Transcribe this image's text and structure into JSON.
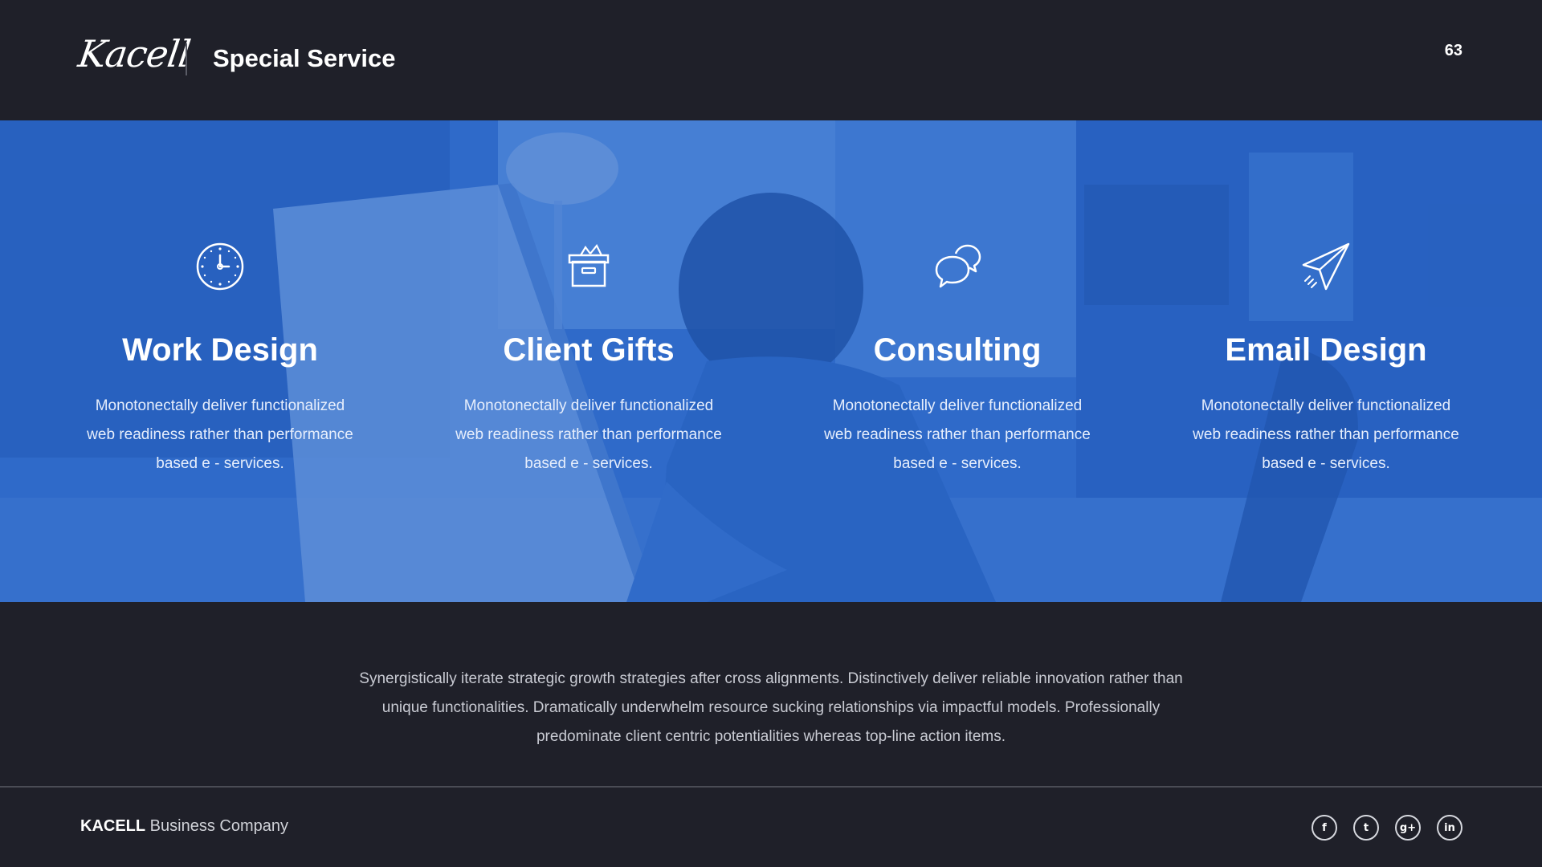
{
  "header": {
    "logo_text": "Kacell",
    "title": "Special Service",
    "page_number": "63"
  },
  "services": [
    {
      "icon": "clock-icon",
      "title": "Work Design",
      "description": "Monotonectally deliver functionalized web readiness rather than performance based e - services."
    },
    {
      "icon": "gift-box-icon",
      "title": "Client Gifts",
      "description": "Monotonectally deliver functionalized web readiness rather than performance based e - services."
    },
    {
      "icon": "chat-bubbles-icon",
      "title": "Consulting",
      "description": "Monotonectally deliver functionalized web readiness rather than performance based e - services."
    },
    {
      "icon": "paper-plane-icon",
      "title": "Email Design",
      "description": "Monotonectally deliver functionalized web readiness rather than performance based e - services."
    }
  ],
  "summary": "Synergistically iterate strategic growth strategies after cross alignments. Distinctively deliver reliable innovation rather than unique functionalities. Dramatically underwhelm resource sucking relationships via impactful models. Professionally predominate client centric potentialities whereas top-line action items.",
  "footer": {
    "company_strong": "KACELL",
    "company_rest": " Business Company",
    "social": [
      {
        "icon": "facebook-icon",
        "glyph": "f"
      },
      {
        "icon": "twitter-icon",
        "glyph": "t"
      },
      {
        "icon": "google-plus-icon",
        "glyph": "g+"
      },
      {
        "icon": "linkedin-icon",
        "glyph": "in"
      }
    ]
  },
  "colors": {
    "background": "#1f2029",
    "hero_tint": "#2662c4",
    "text": "#ffffff"
  }
}
